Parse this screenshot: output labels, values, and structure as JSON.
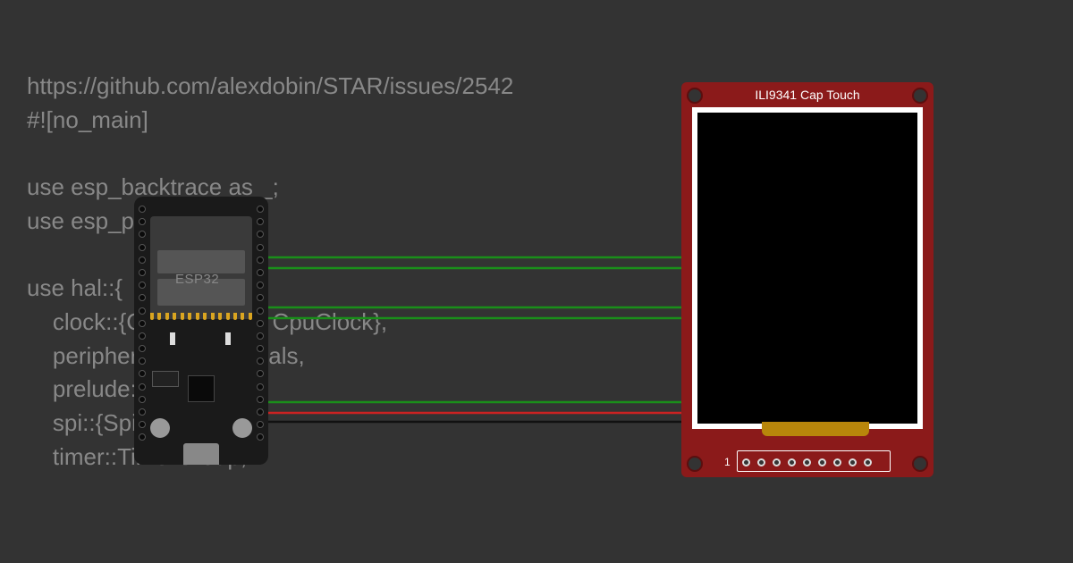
{
  "code": {
    "line1": "https://github.com/alexdobin/STAR/issues/2542",
    "line2": "#![no_main]",
    "line3": "",
    "line4": "use esp_backtrace as _;",
    "line5": "use esp_println::println;",
    "line6": "",
    "line7": "use hal::{",
    "line8": "    clock::{ClockControl, CpuClock},",
    "line9": "    peripherals::Peripherals,",
    "line10": "    prelude::*,",
    "line11": "    spi::{Spi, SpiMode},",
    "line12": "    timer::TimerGroup,"
  },
  "components": {
    "mcu": {
      "label": "ESP32"
    },
    "display": {
      "label": "ILI9341 Cap Touch",
      "pin1_marker": "1",
      "pin_count": 9
    }
  },
  "wires": [
    {
      "color": "#1a8f1a",
      "from": "esp32-right-upper",
      "to": "disp-pin-6"
    },
    {
      "color": "#1a8f1a",
      "from": "esp32-right-upper2",
      "to": "disp-pin-5"
    },
    {
      "color": "#1a8f1a",
      "from": "esp32-right-mid",
      "to": "disp-pin-4"
    },
    {
      "color": "#1a8f1a",
      "from": "esp32-right-lower",
      "to": "disp-pin-3"
    },
    {
      "color": "#cc2222",
      "from": "esp32-3v3",
      "to": "disp-pin-2"
    },
    {
      "color": "#111111",
      "from": "esp32-gnd",
      "to": "disp-pin-1"
    }
  ]
}
